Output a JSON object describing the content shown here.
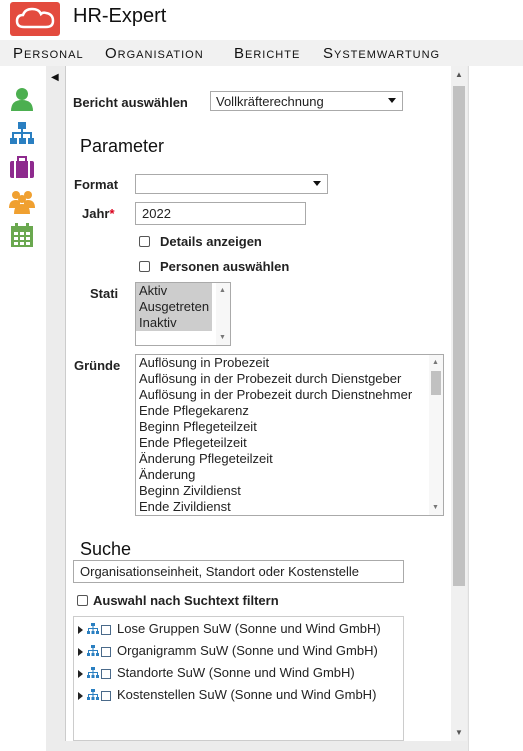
{
  "app": {
    "title": "HR-Expert"
  },
  "menu": [
    "Personal",
    "Organisation",
    "Berichte",
    "Systemwartung"
  ],
  "sidebar": {
    "icons": [
      "person-icon",
      "org-chart-icon",
      "briefcase-icon",
      "group-icon",
      "calendar-icon"
    ]
  },
  "report": {
    "label": "Bericht auswählen",
    "value": "Vollkräfterechnung"
  },
  "parameter": {
    "heading": "Parameter",
    "format_label": "Format",
    "format_value": "",
    "jahr_label": "Jahr",
    "jahr_required": "*",
    "jahr_value": "2022",
    "details_label": "Details anzeigen",
    "personen_label": "Personen auswählen",
    "stati_label": "Stati",
    "stati": [
      "Aktiv",
      "Ausgetreten",
      "Inaktiv"
    ],
    "gruende_label": "Gründe",
    "gruende": [
      "Auflösung in Probezeit",
      "Auflösung in der Probezeit durch Dienstgeber",
      "Auflösung in der Probezeit durch Dienstnehmer",
      "Ende Pflegekarenz",
      "Beginn Pflegeteilzeit",
      "Ende Pflegeteilzeit",
      "Änderung Pflegeteilzeit",
      "Änderung",
      "Beginn Zivildienst",
      "Ende Zivildienst"
    ]
  },
  "suche": {
    "heading": "Suche",
    "placeholder": "Organisationseinheit, Standort oder Kostenstelle",
    "filter_label": "Auswahl nach Suchtext filtern",
    "tree": [
      "Lose Gruppen SuW (Sonne und Wind GmbH)",
      "Organigramm SuW (Sonne und Wind GmbH)",
      "Standorte SuW (Sonne und Wind GmbH)",
      "Kostenstellen SuW (Sonne und Wind GmbH)"
    ]
  },
  "colors": {
    "brand": "#e34b3e",
    "person": "#4caf50",
    "org": "#2a7fc1",
    "briefcase": "#8e2a8e",
    "group": "#f0a030",
    "calendar": "#6aa84f"
  }
}
